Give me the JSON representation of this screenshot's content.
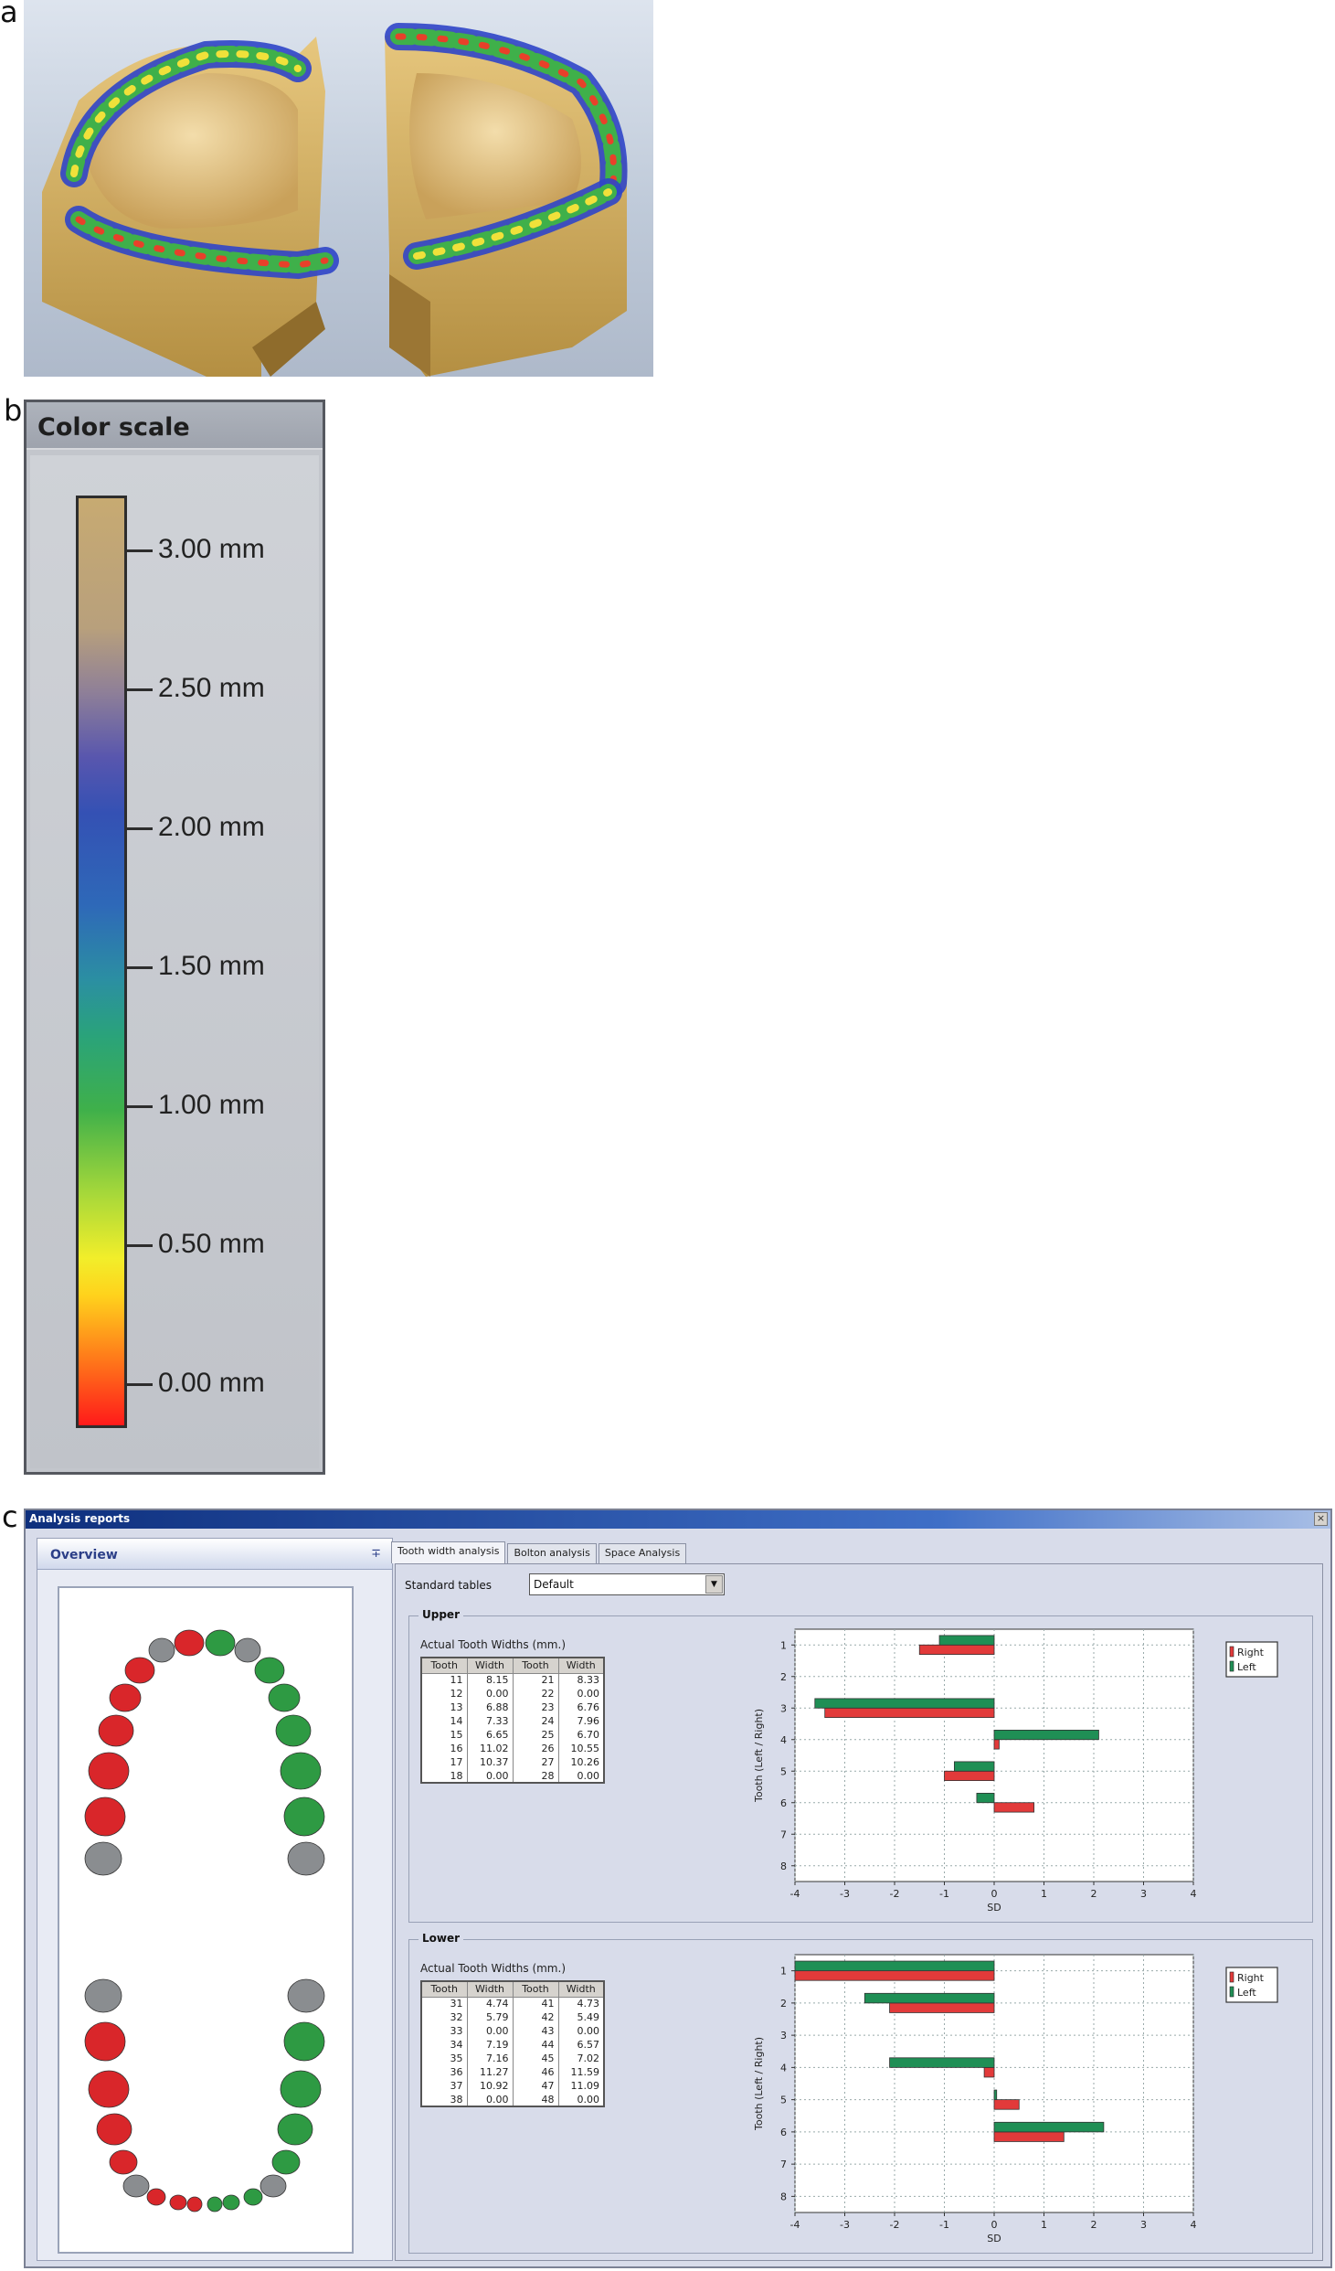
{
  "figure_labels": {
    "a": "a",
    "b": "b",
    "c": "c"
  },
  "color_scale": {
    "title": "Color scale",
    "ticks": [
      "3.00 mm",
      "2.50 mm",
      "2.00 mm",
      "1.50 mm",
      "1.00 mm",
      "0.50 mm",
      "0.00 mm"
    ]
  },
  "window": {
    "title": "Analysis reports",
    "close_label": "×",
    "overview_title": "Overview",
    "overview_pin": "∓",
    "tabs": [
      "Tooth width analysis",
      "Bolton analysis",
      "Space Analysis"
    ],
    "standard_tables_label": "Standard tables",
    "standard_tables_value": "Default"
  },
  "upper": {
    "title": "Upper",
    "table_label": "Actual Tooth Widths (mm.)",
    "headers": [
      "Tooth",
      "Width",
      "Tooth",
      "Width"
    ],
    "rows": [
      [
        "11",
        "8.15",
        "21",
        "8.33"
      ],
      [
        "12",
        "0.00",
        "22",
        "0.00"
      ],
      [
        "13",
        "6.88",
        "23",
        "6.76"
      ],
      [
        "14",
        "7.33",
        "24",
        "7.96"
      ],
      [
        "15",
        "6.65",
        "25",
        "6.70"
      ],
      [
        "16",
        "11.02",
        "26",
        "10.55"
      ],
      [
        "17",
        "10.37",
        "27",
        "10.26"
      ],
      [
        "18",
        "0.00",
        "28",
        "0.00"
      ]
    ]
  },
  "lower": {
    "title": "Lower",
    "table_label": "Actual Tooth Widths (mm.)",
    "headers": [
      "Tooth",
      "Width",
      "Tooth",
      "Width"
    ],
    "rows": [
      [
        "31",
        "4.74",
        "41",
        "4.73"
      ],
      [
        "32",
        "5.79",
        "42",
        "5.49"
      ],
      [
        "33",
        "0.00",
        "43",
        "0.00"
      ],
      [
        "34",
        "7.19",
        "44",
        "6.57"
      ],
      [
        "35",
        "7.16",
        "45",
        "7.02"
      ],
      [
        "36",
        "11.27",
        "46",
        "11.59"
      ],
      [
        "37",
        "10.92",
        "47",
        "11.09"
      ],
      [
        "38",
        "0.00",
        "48",
        "0.00"
      ]
    ]
  },
  "chart_data": [
    {
      "type": "bar",
      "orientation": "horizontal",
      "panel": "Upper",
      "categories": [
        "1",
        "2",
        "3",
        "4",
        "5",
        "6",
        "7",
        "8"
      ],
      "series": [
        {
          "name": "Right",
          "color": "#e23a3a",
          "values": [
            -1.5,
            0,
            -3.4,
            0.1,
            -1.0,
            0.8,
            0,
            0
          ]
        },
        {
          "name": "Left",
          "color": "#1f8f55",
          "values": [
            -1.1,
            0,
            -3.6,
            2.1,
            -0.8,
            -0.35,
            0,
            0
          ]
        }
      ],
      "xlabel": "SD",
      "ylabel": "Tooth (Left / Right)",
      "xlim": [
        -4,
        4
      ],
      "xticks": [
        "-4",
        "-3",
        "-2",
        "-1",
        "0",
        "1",
        "2",
        "3",
        "4"
      ],
      "grid": true,
      "legend": "right"
    },
    {
      "type": "bar",
      "orientation": "horizontal",
      "panel": "Lower",
      "categories": [
        "1",
        "2",
        "3",
        "4",
        "5",
        "6",
        "7",
        "8"
      ],
      "series": [
        {
          "name": "Right",
          "color": "#e23a3a",
          "values": [
            -4.0,
            -2.1,
            0,
            -0.2,
            0.5,
            1.4,
            0,
            0
          ]
        },
        {
          "name": "Left",
          "color": "#1f8f55",
          "values": [
            -4.0,
            -2.6,
            0,
            -2.1,
            0.05,
            2.2,
            0,
            0
          ]
        }
      ],
      "xlabel": "SD",
      "ylabel": "Tooth (Left / Right)",
      "xlim": [
        -4,
        4
      ],
      "xticks": [
        "-4",
        "-3",
        "-2",
        "-1",
        "0",
        "1",
        "2",
        "3",
        "4"
      ],
      "grid": true,
      "legend": "right"
    }
  ]
}
